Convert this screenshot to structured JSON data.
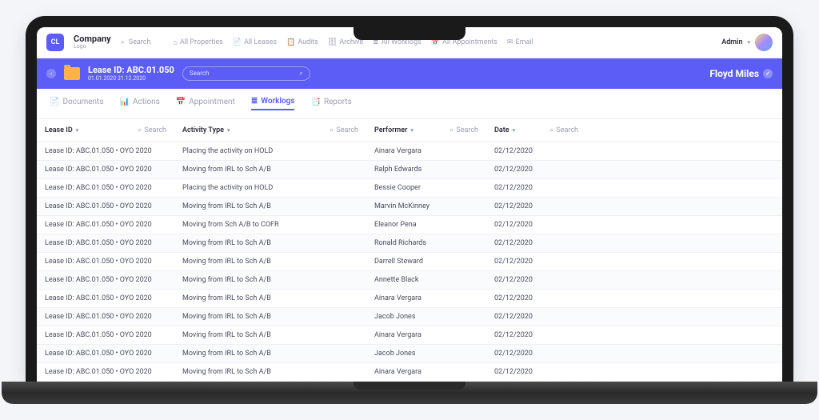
{
  "topbar": {
    "logo_initials": "CL",
    "company_name": "Company",
    "company_sub": "Logo",
    "search_placeholder": "Search",
    "nav": [
      {
        "label": "All Properties"
      },
      {
        "label": "All Leases"
      },
      {
        "label": "Audits"
      },
      {
        "label": "Archive"
      },
      {
        "label": "All Worklogs"
      },
      {
        "label": "All Appointments"
      },
      {
        "label": "Email"
      }
    ],
    "admin_label": "Admin"
  },
  "header": {
    "lease_title": "Lease ID: ABC.01.050",
    "lease_dates": "01.01.2020 31.12.2020",
    "search_placeholder": "Search",
    "user_name": "Floyd Miles"
  },
  "tabs": [
    {
      "label": "Documents",
      "active": false
    },
    {
      "label": "Actions",
      "active": false
    },
    {
      "label": "Appointment",
      "active": false
    },
    {
      "label": "Worklogs",
      "active": true
    },
    {
      "label": "Reports",
      "active": false
    }
  ],
  "table": {
    "columns": [
      {
        "label": "Lease ID",
        "search": "Search"
      },
      {
        "label": "Activity Type",
        "search": "Search"
      },
      {
        "label": "Performer",
        "search": "Search"
      },
      {
        "label": "Date",
        "search": "Search"
      }
    ],
    "rows": [
      {
        "lease": "Lease ID: ABC.01.050 • OYO 2020",
        "activity": "Placing the activity on HOLD",
        "performer": "Ainara Vergara",
        "date": "02/12/2020"
      },
      {
        "lease": "Lease ID: ABC.01.050 • OYO 2020",
        "activity": "Moving from IRL to Sch A/B",
        "performer": "Ralph Edwards",
        "date": "02/12/2020"
      },
      {
        "lease": "Lease ID: ABC.01.050 • OYO 2020",
        "activity": "Placing the activity on HOLD",
        "performer": "Bessie Cooper",
        "date": "02/12/2020"
      },
      {
        "lease": "Lease ID: ABC.01.050 • OYO 2020",
        "activity": "Moving from IRL to Sch A/B",
        "performer": "Marvin McKinney",
        "date": "02/12/2020"
      },
      {
        "lease": "Lease ID: ABC.01.050 • OYO 2020",
        "activity": "Moving from Sch A/B to COFR",
        "performer": "Eleanor Pena",
        "date": "02/12/2020"
      },
      {
        "lease": "Lease ID: ABC.01.050 • OYO 2020",
        "activity": "Moving from IRL to Sch A/B",
        "performer": "Ronald Richards",
        "date": "02/12/2020"
      },
      {
        "lease": "Lease ID: ABC.01.050 • OYO 2020",
        "activity": "Moving from IRL to Sch A/B",
        "performer": "Darrell Steward",
        "date": "02/12/2020"
      },
      {
        "lease": "Lease ID: ABC.01.050 • OYO 2020",
        "activity": "Moving from IRL to Sch A/B",
        "performer": "Annette Black",
        "date": "02/12/2020"
      },
      {
        "lease": "Lease ID: ABC.01.050 • OYO 2020",
        "activity": "Moving from IRL to Sch A/B",
        "performer": "Ainara Vergara",
        "date": "02/12/2020"
      },
      {
        "lease": "Lease ID: ABC.01.050 • OYO 2020",
        "activity": "Moving from IRL to Sch A/B",
        "performer": "Jacob Jones",
        "date": "02/12/2020"
      },
      {
        "lease": "Lease ID: ABC.01.050 • OYO 2020",
        "activity": "Moving from IRL to Sch A/B",
        "performer": "Ainara Vergara",
        "date": "02/12/2020"
      },
      {
        "lease": "Lease ID: ABC.01.050 • OYO 2020",
        "activity": "Moving from IRL to Sch A/B",
        "performer": "Jacob Jones",
        "date": "02/12/2020"
      },
      {
        "lease": "Lease ID: ABC.01.050 • OYO 2020",
        "activity": "Moving from IRL to Sch A/B",
        "performer": "Ainara Vergara",
        "date": "02/12/2020"
      }
    ]
  }
}
